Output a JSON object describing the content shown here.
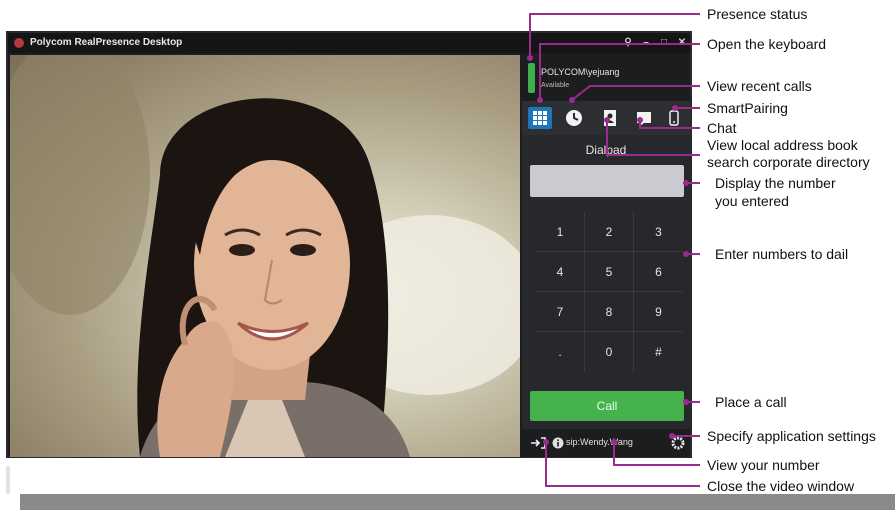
{
  "window": {
    "title": "Polycom RealPresence Desktop",
    "controls": [
      "pin-icon",
      "minimize-icon",
      "maximize-icon",
      "close-icon"
    ]
  },
  "user": {
    "name": "POLYCOM\\yejuang",
    "status": "Available",
    "presence_color": "#3db04d"
  },
  "nav": {
    "items": [
      {
        "name": "keypad-icon",
        "active": true
      },
      {
        "name": "recent-calls-icon",
        "active": false
      },
      {
        "name": "address-book-icon",
        "active": false
      },
      {
        "name": "chat-icon",
        "active": false
      },
      {
        "name": "smartpairing-icon",
        "active": false
      }
    ]
  },
  "dialpad": {
    "title": "Dialpad",
    "keys": [
      "1",
      "2",
      "3",
      "4",
      "5",
      "6",
      "7",
      "8",
      "9",
      ".",
      "0",
      "#"
    ]
  },
  "call": {
    "label": "Call",
    "color": "#45b24d"
  },
  "bottom": {
    "sip_number": "sip:Wendy.Wang"
  },
  "annotations": [
    "Presence status",
    "Open the keyboard",
    "View recent calls",
    "SmartPairing",
    "Chat",
    "View local address book",
    "search corporate directory",
    "Display the number",
    "you entered",
    "Enter numbers to dail",
    "Place a call",
    "Specify application settings",
    "View your number",
    "Close the video window"
  ],
  "colors": {
    "annotation_line": "#9b2a8f",
    "accent": "#1f75b5"
  }
}
